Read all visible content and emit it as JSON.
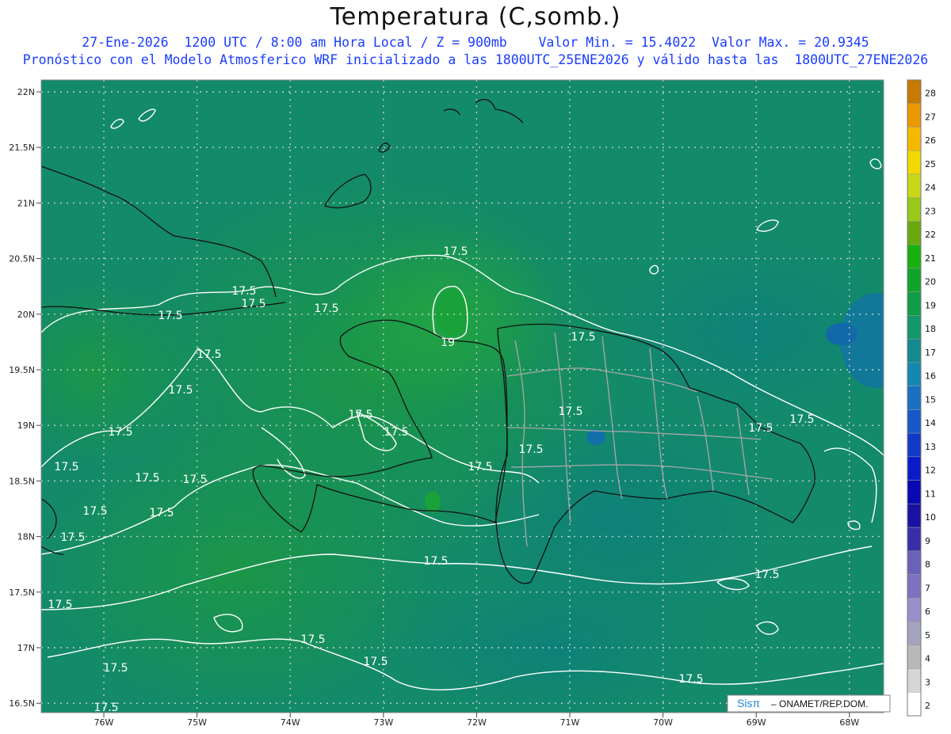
{
  "title": "Temperatura (C,somb.)",
  "subtitle_line1": "27-Ene-2026  1200 UTC / 8:00 am Hora Local / Z = 900mb    Valor Min. = 15.4022  Valor Max. = 20.9345",
  "subtitle_line2": "Pronóstico con el Modelo Atmosferico WRF inicializado a las 1800UTC_25ENE2026 y válido hasta las  1800UTC_27ENE2026",
  "lat_labels": [
    "22N",
    "21.5N",
    "21N",
    "20.5N",
    "20N",
    "19.5N",
    "19N",
    "18.5N",
    "18N",
    "17.5N",
    "17N",
    "16.5N"
  ],
  "lon_labels": [
    "76W",
    "75W",
    "74W",
    "73W",
    "72W",
    "71W",
    "70W",
    "69W",
    "68W"
  ],
  "colorbar": {
    "values": [
      2,
      3,
      4,
      5,
      6,
      7,
      8,
      9,
      10,
      11,
      12,
      13,
      14,
      15,
      16,
      17,
      18,
      19,
      20,
      21,
      22,
      23,
      24,
      25,
      26,
      27,
      28
    ],
    "colors": [
      "#ffffff",
      "#d6d6d6",
      "#b8b8b8",
      "#a3a3bd",
      "#9a8fc9",
      "#7f72c2",
      "#6a62b8",
      "#3a2ea8",
      "#1a12a0",
      "#0a08b0",
      "#0a1cc8",
      "#0f3ac8",
      "#1658c8",
      "#1a70c0",
      "#1488b0",
      "#128a90",
      "#12986a",
      "#119c48",
      "#0fa52a",
      "#1ab010",
      "#6aa810",
      "#98c81a",
      "#c8d818",
      "#f0d800",
      "#f5b800",
      "#e89a00",
      "#c87a00"
    ]
  },
  "contour_labels": [
    "17.5",
    "17.5",
    "17.5",
    "17.5",
    "17.5",
    "17.5",
    "17.5",
    "17.5",
    "17.5",
    "17.5",
    "17.5",
    "17.5",
    "17.5",
    "17.5",
    "17.5",
    "17.5",
    "17.5",
    "17.5",
    "17.5",
    "17.5",
    "17.5",
    "17.5",
    "17.5",
    "17.5",
    "17.5",
    "17.5",
    "19"
  ],
  "credit": {
    "brand": "Sisπ",
    "text": "– ONAMET/REP.DOM."
  }
}
